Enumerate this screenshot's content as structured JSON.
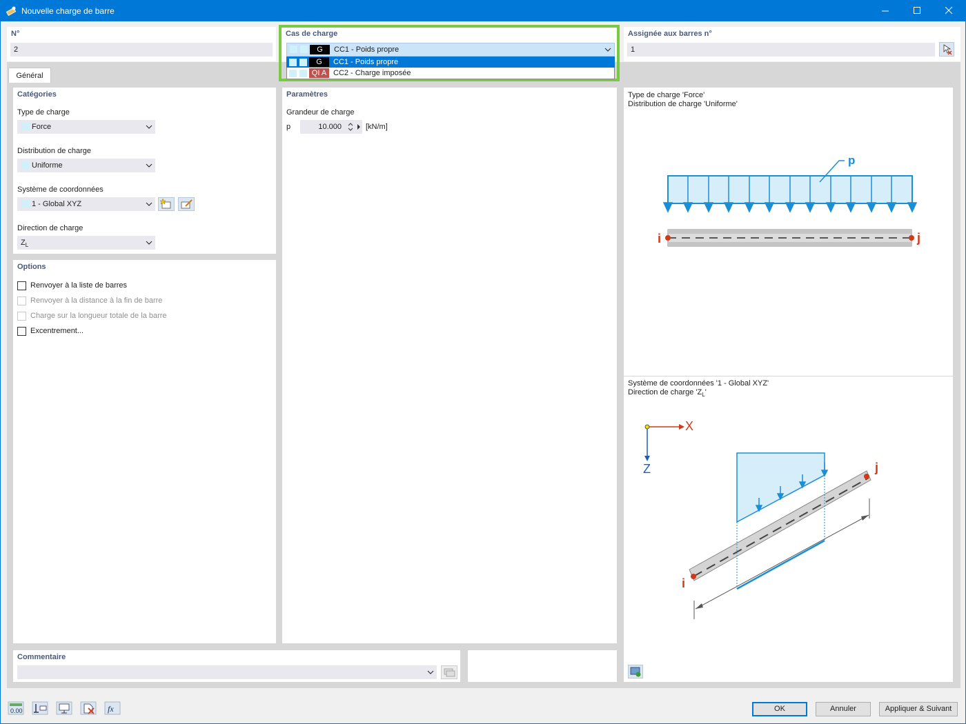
{
  "window": {
    "title": "Nouvelle charge de barre",
    "minimize": "—",
    "maximize": "☐",
    "close": "✕"
  },
  "no": {
    "label": "N°",
    "value": "2"
  },
  "load_case": {
    "label": "Cas de charge",
    "selected": {
      "badge": "G",
      "text": "CC1 - Poids propre"
    },
    "options": [
      {
        "badge": "G",
        "text": "CC1 - Poids propre",
        "badge_color": "#000000",
        "highlighted": true
      },
      {
        "badge": "QI A",
        "text": "CC2 - Charge imposée",
        "badge_color": "#c0504d",
        "highlighted": false
      }
    ]
  },
  "assigned": {
    "label": "Assignée aux barres n°",
    "value": "1"
  },
  "tabs": [
    "Général"
  ],
  "categories": {
    "title": "Catégories",
    "load_type": {
      "label": "Type de charge",
      "value": "Force"
    },
    "distribution": {
      "label": "Distribution de charge",
      "value": "Uniforme"
    },
    "coord_system": {
      "label": "Système de coordonnées",
      "value": "1 - Global XYZ"
    },
    "direction": {
      "label": "Direction de charge",
      "value": "Z",
      "value_sub": "L"
    }
  },
  "options": {
    "title": "Options",
    "items": [
      {
        "label": "Renvoyer à la liste de barres",
        "enabled": true,
        "checked": false
      },
      {
        "label": "Renvoyer à la distance à la fin de barre",
        "enabled": false,
        "checked": false
      },
      {
        "label": "Charge sur la longueur totale de la barre",
        "enabled": false,
        "checked": false
      },
      {
        "label": "Excentrement...",
        "enabled": true,
        "checked": false
      }
    ]
  },
  "parameters": {
    "title": "Paramètres",
    "group": "Grandeur de charge",
    "symbol": "p",
    "value": "10.000",
    "unit": "[kN/m]"
  },
  "preview_top": {
    "line1": "Type de charge 'Force'",
    "line2": "Distribution de charge 'Uniforme'",
    "p_label": "p",
    "i_label": "i",
    "j_label": "j"
  },
  "preview_bottom": {
    "line1": "Système de coordonnées '1 - Global XYZ'",
    "line2_prefix": "Direction de charge 'Z",
    "line2_sub": "L",
    "line2_suffix": "'",
    "x_label": "X",
    "z_label": "Z",
    "i_label": "i",
    "j_label": "j"
  },
  "comment": {
    "label": "Commentaire",
    "value": ""
  },
  "buttons": {
    "ok": "OK",
    "cancel": "Annuler",
    "apply_next": "Appliquer & Suivant"
  },
  "bottom_icons": [
    "units-icon",
    "model-icon",
    "view-icon",
    "delete-icon",
    "formula-icon"
  ],
  "colors": {
    "accent": "#0078d7",
    "load_blue": "#1a8fd6",
    "load_fill": "#d6eef9",
    "node_red": "#d03a1a",
    "highlight_green": "#7ac943"
  }
}
